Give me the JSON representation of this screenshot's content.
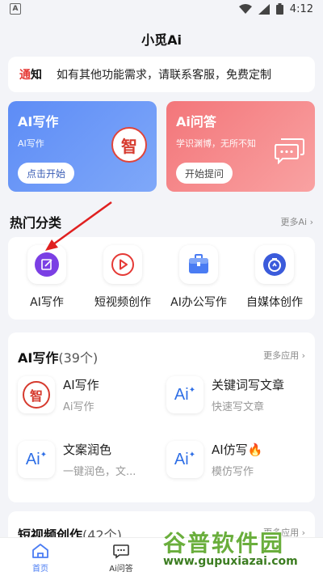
{
  "status_bar": {
    "app_indicator": "A",
    "time": "4:12"
  },
  "header": {
    "title": "小觅Ai"
  },
  "notice": {
    "tag_a": "通",
    "tag_b": "知",
    "text": "如有其他功能需求，请联系客服，免费定制"
  },
  "cards": [
    {
      "title": "AI写作",
      "subtitle": "AI写作",
      "button": "点击开始",
      "badge": "智"
    },
    {
      "title": "Ai问答",
      "subtitle": "学识渊博，无所不知",
      "button": "开始提问"
    }
  ],
  "hot": {
    "title": "热门分类",
    "more": "更多Ai",
    "items": [
      {
        "label": "AI写作",
        "icon": "edit-icon",
        "color": "#7b3fe4"
      },
      {
        "label": "短视频创作",
        "icon": "play-icon",
        "color": "#e53935"
      },
      {
        "label": "AI办公写作",
        "icon": "briefcase-icon",
        "color": "#4a7cf3"
      },
      {
        "label": "自媒体创作",
        "icon": "media-icon",
        "color": "#3b5bdb"
      }
    ]
  },
  "writing": {
    "title": "AI写作",
    "count": "(39个)",
    "more": "更多应用",
    "apps": [
      {
        "name": "AI写作",
        "desc": "Ai写作",
        "icon": "智"
      },
      {
        "name": "关键词写文章",
        "desc": "快速写文章",
        "icon": "Ai"
      },
      {
        "name": "文案润色",
        "desc": "一键润色，文...",
        "icon": "Ai"
      },
      {
        "name": "AI仿写",
        "desc": "模仿写作",
        "icon": "Ai"
      }
    ]
  },
  "video": {
    "title": "短视频创作",
    "count": "(42个)",
    "more": "更多应用"
  },
  "tabs": [
    {
      "label": "首页",
      "active": true
    },
    {
      "label": "Ai问答",
      "active": false
    }
  ],
  "watermark": {
    "top": "谷普软件园",
    "bottom": "www.gupuxiazai.com"
  },
  "colors": {
    "accent": "#4a7cf3",
    "red": "#e53935",
    "card_blue": "#6a96f7",
    "card_red": "#f58a8c"
  }
}
